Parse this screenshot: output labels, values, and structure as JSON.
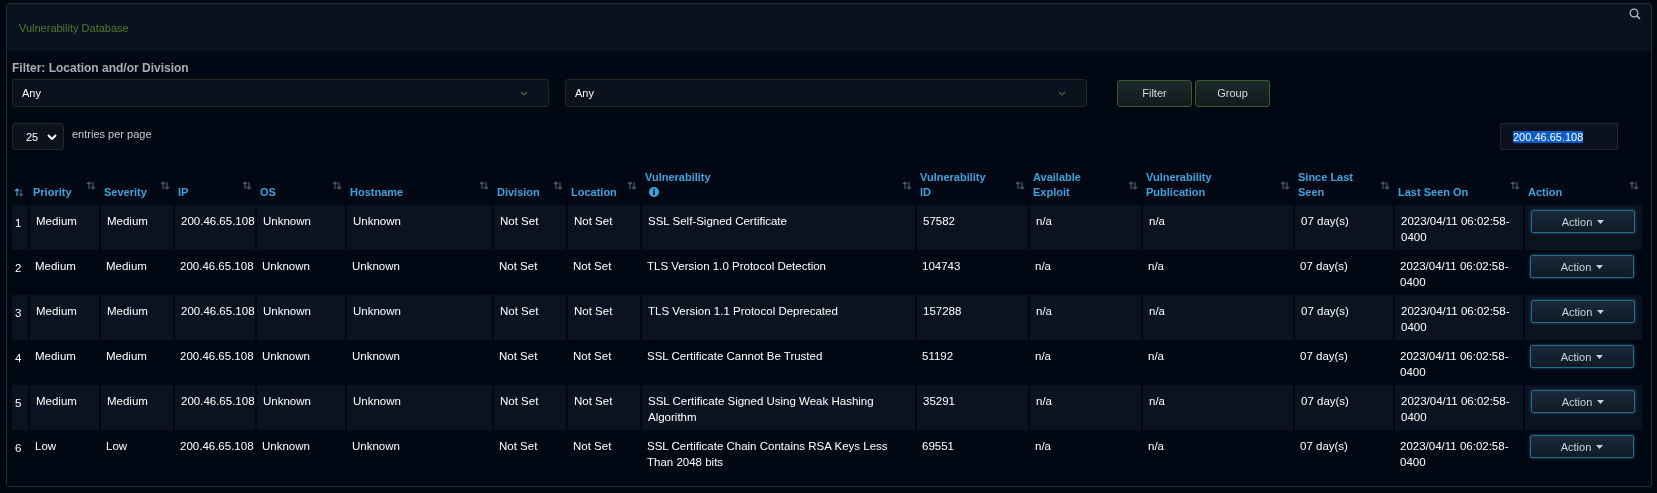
{
  "panel": {
    "title": "Vulnerability Database"
  },
  "filter": {
    "label": "Filter: Location and/or Division",
    "selects": [
      {
        "value": "Any"
      },
      {
        "value": "Any"
      }
    ],
    "buttons": [
      "Filter",
      "Group"
    ]
  },
  "entries": {
    "value": "25",
    "label": "entries per page"
  },
  "search": {
    "value": "200.46.65.108",
    "selected": true
  },
  "table": {
    "columns": [
      {
        "sorted": true
      },
      {
        "label": "Priority",
        "sorted": false
      },
      {
        "label": "Severity",
        "sorted": false
      },
      {
        "label": "IP",
        "sorted": false
      },
      {
        "label": "OS",
        "sorted": false
      },
      {
        "label": "Hostname",
        "sorted": false
      },
      {
        "label": "Division",
        "sorted": false
      },
      {
        "label": "Location",
        "sorted": false
      },
      {
        "label": "Vulnerability",
        "sorted": false,
        "info": true
      },
      {
        "label": "Vulnerability ID",
        "sorted": false
      },
      {
        "label": "Available Exploit",
        "sorted": false
      },
      {
        "label": "Vulnerability Publication",
        "sorted": false
      },
      {
        "label": "Since Last Seen",
        "sorted": false
      },
      {
        "label": "Last Seen On",
        "sorted": false
      },
      {
        "label": "Action",
        "sorted": false
      }
    ],
    "rows": [
      {
        "cells": [
          "1",
          "Medium",
          "Medium",
          "200.46.65.108",
          "Unknown",
          "Unknown",
          "Not Set",
          "Not Set",
          "SSL Self-Signed Certificate",
          "57582",
          "n/a",
          "n/a",
          "07 day(s)",
          "2023/04/11 06:02:58-0400"
        ],
        "action": "Action"
      },
      {
        "cells": [
          "2",
          "Medium",
          "Medium",
          "200.46.65.108",
          "Unknown",
          "Unknown",
          "Not Set",
          "Not Set",
          "TLS Version 1.0 Protocol Detection",
          "104743",
          "n/a",
          "n/a",
          "07 day(s)",
          "2023/04/11 06:02:58-0400"
        ],
        "action": "Action"
      },
      {
        "cells": [
          "3",
          "Medium",
          "Medium",
          "200.46.65.108",
          "Unknown",
          "Unknown",
          "Not Set",
          "Not Set",
          "TLS Version 1.1 Protocol Deprecated",
          "157288",
          "n/a",
          "n/a",
          "07 day(s)",
          "2023/04/11 06:02:58-0400"
        ],
        "action": "Action"
      },
      {
        "cells": [
          "4",
          "Medium",
          "Medium",
          "200.46.65.108",
          "Unknown",
          "Unknown",
          "Not Set",
          "Not Set",
          "SSL Certificate Cannot Be Trusted",
          "51192",
          "n/a",
          "n/a",
          "07 day(s)",
          "2023/04/11 06:02:58-0400"
        ],
        "action": "Action"
      },
      {
        "cells": [
          "5",
          "Medium",
          "Medium",
          "200.46.65.108",
          "Unknown",
          "Unknown",
          "Not Set",
          "Not Set",
          "SSL Certificate Signed Using Weak Hashing Algorithm",
          "35291",
          "n/a",
          "n/a",
          "07 day(s)",
          "2023/04/11 06:02:58-0400"
        ],
        "action": "Action"
      },
      {
        "cells": [
          "6",
          "Low",
          "Low",
          "200.46.65.108",
          "Unknown",
          "Unknown",
          "Not Set",
          "Not Set",
          "SSL Certificate Chain Contains RSA Keys Less Than 2048 bits",
          "69551",
          "n/a",
          "n/a",
          "07 day(s)",
          "2023/04/11 06:02:58-0400"
        ],
        "action": "Action"
      }
    ]
  }
}
